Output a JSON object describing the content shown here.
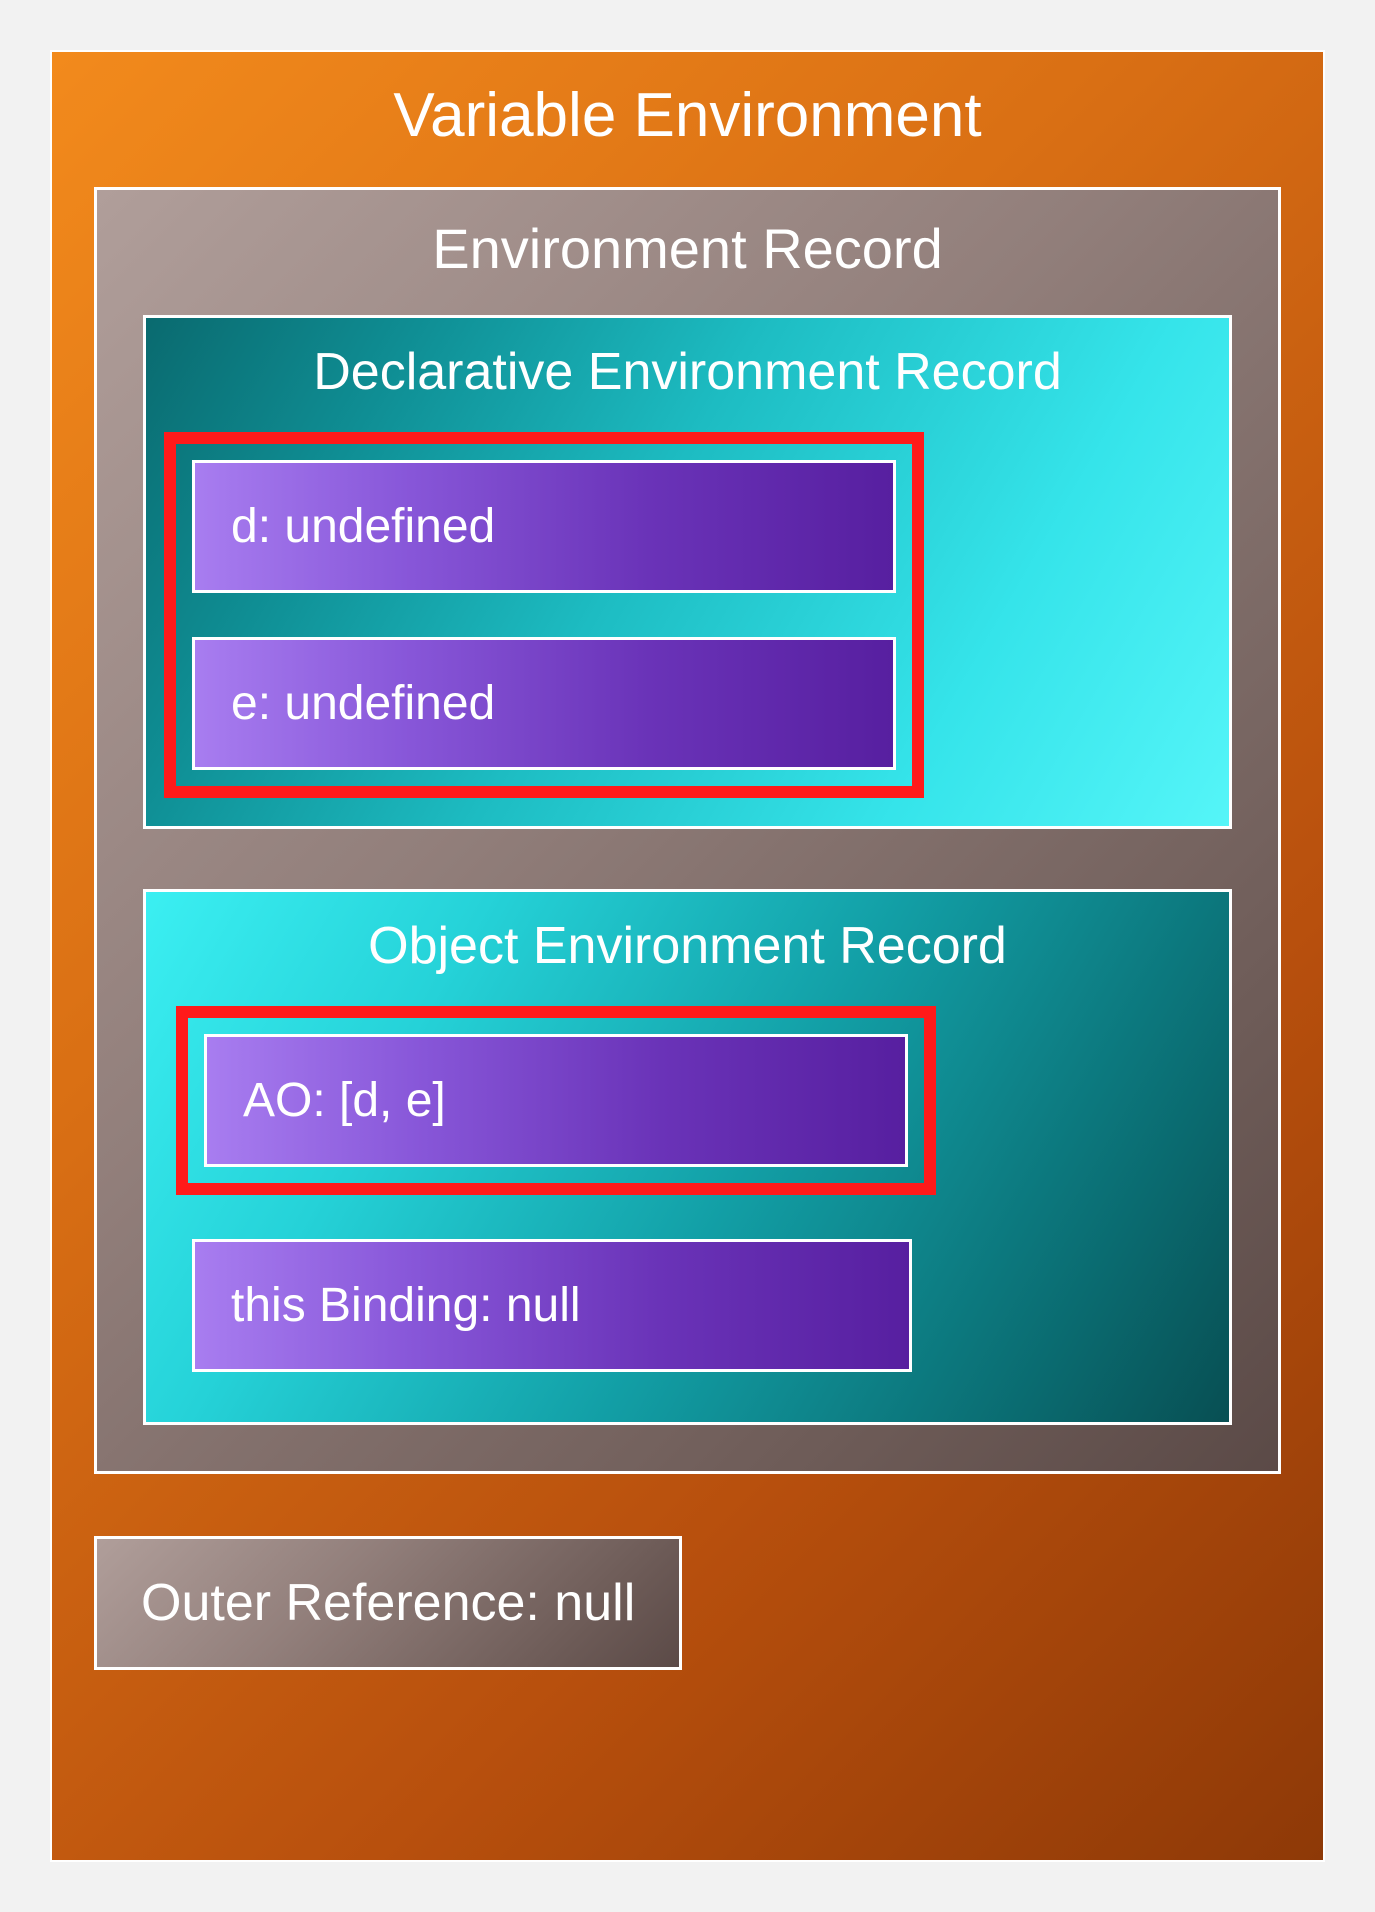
{
  "title": "Variable Environment",
  "envRecord": {
    "title": "Environment Record",
    "declarative": {
      "title": "Declarative Environment Record",
      "entries": [
        {
          "text": "d: undefined"
        },
        {
          "text": "e: undefined"
        }
      ]
    },
    "object": {
      "title": "Object Environment Record",
      "ao": "AO: [d, e]",
      "thisBinding": "this Binding: null"
    }
  },
  "outerReference": "Outer Reference: null",
  "colors": {
    "orangeStart": "#f28a1c",
    "orangeEnd": "#8e3907",
    "brownStart": "#b09e9a",
    "brownEnd": "#5b4a47",
    "tealStart": "#0a6a6f",
    "tealEnd": "#55f5f8",
    "purpleStart": "#a87df0",
    "purpleEnd": "#571fa0",
    "highlight": "#ff1a1a"
  }
}
